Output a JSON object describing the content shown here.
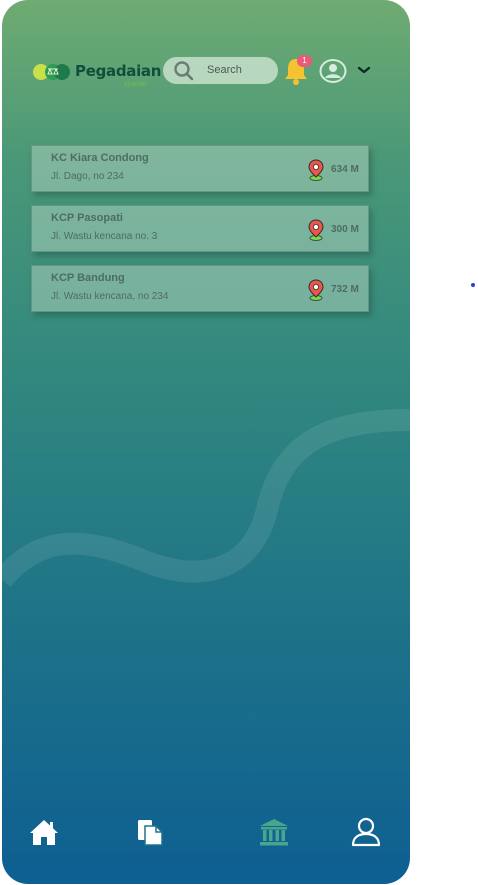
{
  "header": {
    "brand_name": "Pegadaian",
    "brand_sub": "syariah",
    "search_placeholder": "Search",
    "notification_count": "1",
    "icons": {
      "search": "search-icon",
      "notifications": "bell-icon",
      "account": "user-circle-icon",
      "menu": "chevron-down-icon"
    }
  },
  "branches": [
    {
      "name": "KC Kiara Condong",
      "address": "Jl. Dago, no 234",
      "distance": "634 M"
    },
    {
      "name": "KCP Pasopati",
      "address": "Jl. Wastu kencana no. 3",
      "distance": "300 M"
    },
    {
      "name": "KCP Bandung",
      "address": "Jl. Wastu kencana, no 234",
      "distance": "732 M"
    }
  ],
  "bottom_nav": [
    {
      "id": "home",
      "icon": "home-icon"
    },
    {
      "id": "documents",
      "icon": "documents-icon"
    },
    {
      "id": "branch",
      "icon": "bank-icon",
      "active": true
    },
    {
      "id": "profile",
      "icon": "user-icon"
    }
  ],
  "colors": {
    "gradient_top": "#6fab72",
    "gradient_bottom": "#0e5f92",
    "card_text": "#4f6c62",
    "badge": "#e85a77",
    "bell": "#f5c232",
    "pin": "#e8584a",
    "active_nav": "#4aa58e"
  }
}
